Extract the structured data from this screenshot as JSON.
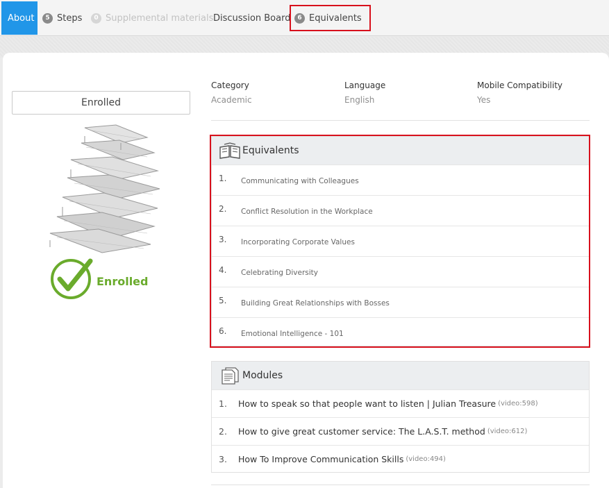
{
  "tabs": [
    {
      "label": "About",
      "badge": null,
      "state": "active"
    },
    {
      "label": "Steps",
      "badge": "5",
      "state": "normal"
    },
    {
      "label": "Supplemental materials",
      "badge": "0",
      "state": "disabled"
    },
    {
      "label": "Discussion Board",
      "badge": null,
      "state": "normal"
    },
    {
      "label": "Equivalents",
      "badge": "6",
      "state": "normal"
    }
  ],
  "left": {
    "enroll_button_label": "Enrolled",
    "status_label": "Enrolled"
  },
  "meta": [
    {
      "key": "Category",
      "value": "Academic"
    },
    {
      "key": "Language",
      "value": "English"
    },
    {
      "key": "Mobile Compatibility",
      "value": "Yes"
    }
  ],
  "equivalents": {
    "title": "Equivalents",
    "items": [
      {
        "num": "1.",
        "title": "Communicating with Colleagues"
      },
      {
        "num": "2.",
        "title": "Conflict Resolution in the Workplace"
      },
      {
        "num": "3.",
        "title": "Incorporating Corporate Values"
      },
      {
        "num": "4.",
        "title": "Celebrating Diversity"
      },
      {
        "num": "5.",
        "title": "Building Great Relationships with Bosses"
      },
      {
        "num": "6.",
        "title": "Emotional Intelligence - 101"
      }
    ]
  },
  "modules": {
    "title": "Modules",
    "items": [
      {
        "num": "1.",
        "title": "How to speak so that people want to listen | Julian Treasure",
        "tag": "(video:598)"
      },
      {
        "num": "2.",
        "title": "How to give great customer service: The L.A.S.T. method",
        "tag": "(video:612)"
      },
      {
        "num": "3.",
        "title": "How To Improve Communication Skills",
        "tag": "(video:494)"
      }
    ]
  },
  "colors": {
    "accent": "#2196e8",
    "highlight": "#d8101c",
    "success": "#6aab2c"
  },
  "icons": {
    "equivalents": "open-book-icon",
    "modules": "documents-icon",
    "status": "checkmark-icon"
  }
}
